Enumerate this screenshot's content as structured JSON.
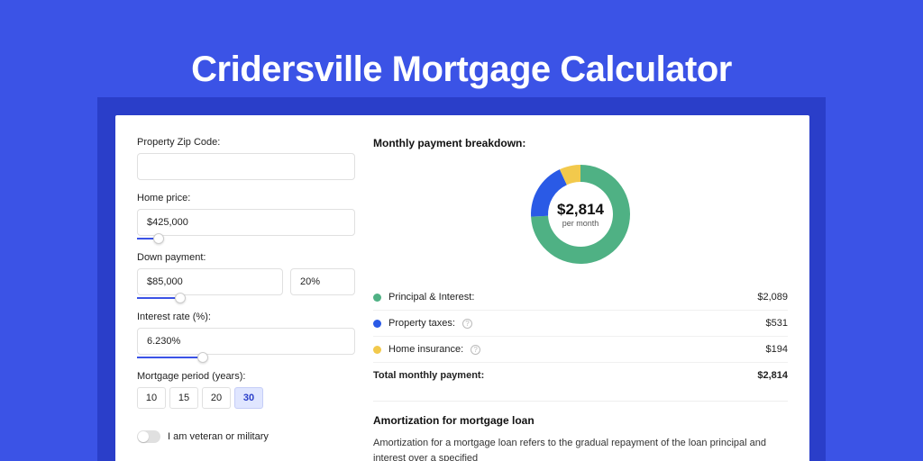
{
  "title": "Cridersville Mortgage Calculator",
  "form": {
    "zip": {
      "label": "Property Zip Code:",
      "value": ""
    },
    "home_price": {
      "label": "Home price:",
      "value": "$425,000",
      "slider_pct": 10
    },
    "down_payment": {
      "label": "Down payment:",
      "value": "$85,000",
      "pct_value": "20%",
      "slider_pct": 20
    },
    "interest_rate": {
      "label": "Interest rate (%):",
      "value": "6.230%",
      "slider_pct": 30
    },
    "mortgage_period": {
      "label": "Mortgage period (years):",
      "options": [
        "10",
        "15",
        "20",
        "30"
      ],
      "selected": "30"
    },
    "veteran": {
      "label": "I am veteran or military",
      "value": false
    }
  },
  "breakdown": {
    "heading": "Monthly payment breakdown:",
    "center_amount": "$2,814",
    "center_sub": "per month",
    "items": [
      {
        "label": "Principal & Interest:",
        "value": "$2,089",
        "color": "#4fb184",
        "has_info": false
      },
      {
        "label": "Property taxes:",
        "value": "$531",
        "color": "#2a5ae6",
        "has_info": true
      },
      {
        "label": "Home insurance:",
        "value": "$194",
        "color": "#f2c94c",
        "has_info": true
      }
    ],
    "total": {
      "label": "Total monthly payment:",
      "value": "$2,814"
    }
  },
  "amortization": {
    "heading": "Amortization for mortgage loan",
    "body": "Amortization for a mortgage loan refers to the gradual repayment of the loan principal and interest over a specified"
  },
  "chart_data": {
    "type": "pie",
    "title": "Monthly payment breakdown",
    "categories": [
      "Principal & Interest",
      "Property taxes",
      "Home insurance"
    ],
    "values": [
      2089,
      531,
      194
    ],
    "colors": [
      "#4fb184",
      "#2a5ae6",
      "#f2c94c"
    ],
    "total": 2814
  }
}
